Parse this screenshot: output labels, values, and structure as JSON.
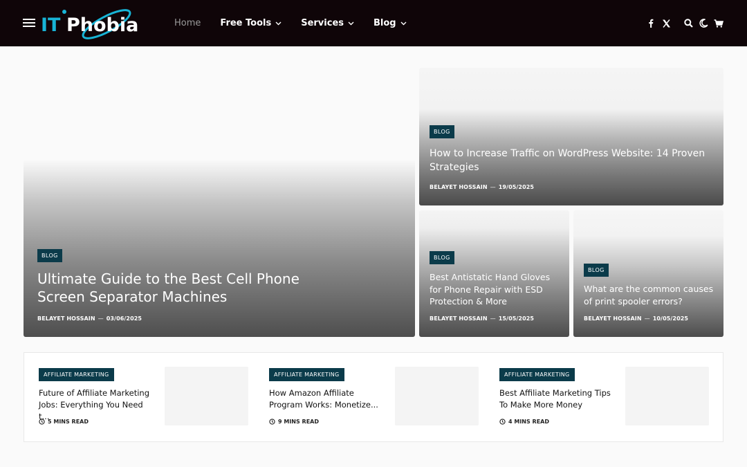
{
  "header": {
    "logo_alt": "IT Phobia",
    "nav": [
      {
        "label": "Home",
        "active": true,
        "dropdown": false
      },
      {
        "label": "Free Tools",
        "active": false,
        "dropdown": true
      },
      {
        "label": "Services",
        "active": false,
        "dropdown": true
      },
      {
        "label": "Blog",
        "active": false,
        "dropdown": true
      }
    ],
    "icons": [
      "facebook-icon",
      "x-twitter-icon",
      "search-icon",
      "dark-mode-moon-icon",
      "cart-icon"
    ],
    "background": "#0f0508",
    "logo_colors": {
      "it": "#18b4d6",
      "phobia": "#ffffff",
      "orbit": "#18b4d6"
    }
  },
  "featured": [
    {
      "tag": "BLOG",
      "title": "Ultimate Guide to the Best Cell Phone Screen Separator Machines",
      "author": "BELAYET HOSSAIN",
      "date": "03/06/2025"
    },
    {
      "tag": "BLOG",
      "title": "How to Increase Traffic on WordPress Website: 14 Proven Strategies",
      "author": "BELAYET HOSSAIN",
      "date": "19/05/2025"
    },
    {
      "tag": "BLOG",
      "title": "Best Antistatic Hand Gloves for Phone Repair with ESD Protection & More",
      "author": "BELAYET HOSSAIN",
      "date": "15/05/2025"
    },
    {
      "tag": "BLOG",
      "title": "What are the common causes of print spooler errors?",
      "author": "BELAYET HOSSAIN",
      "date": "10/05/2025"
    }
  ],
  "meta_separator": "—",
  "posts": [
    {
      "tag": "AFFILIATE MARKETING",
      "title": "Future of Affiliate Marketing Jobs: Everything You Need t...",
      "read": "5 MINS READ"
    },
    {
      "tag": "AFFILIATE MARKETING",
      "title": "How Amazon Affiliate Program Works: Monetize...",
      "read": "9 MINS READ"
    },
    {
      "tag": "AFFILIATE MARKETING",
      "title": "Best Affiliate Marketing Tips To Make More Money",
      "read": "4 MINS READ"
    }
  ],
  "colors": {
    "tag_bg": "#0b3b4a",
    "page_bg": "#fafafa"
  }
}
